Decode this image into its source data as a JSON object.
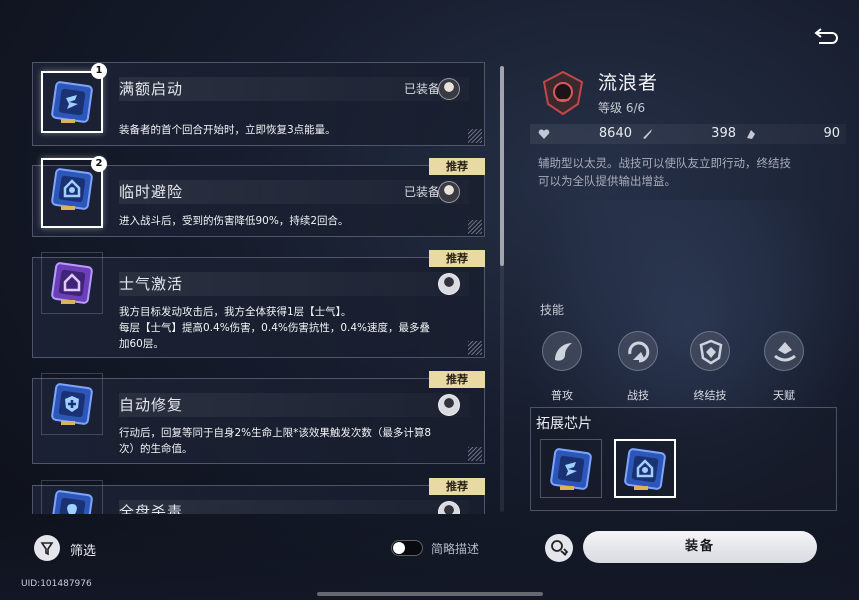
{
  "cards": [
    {
      "name": "满额启动",
      "equipped_label": "已装备",
      "number": "1",
      "desc": "装备者的首个回合开始时，立即恢复3点能量。"
    },
    {
      "name": "临时避险",
      "equipped_label": "已装备",
      "number": "2",
      "recommend": "推荐",
      "desc": "进入战斗后，受到的伤害降低90%，持续2回合。"
    },
    {
      "name": "士气激活",
      "recommend": "推荐",
      "desc_lines": [
        "我方目标发动攻击后，我方全体获得1层【士气】。",
        "每层【士气】提高0.4%伤害，0.4%伤害抗性，0.4%速度，最多叠",
        "加60层。"
      ]
    },
    {
      "name": "自动修复",
      "recommend": "推荐",
      "desc_lines": [
        "行动后，回复等同于自身2%生命上限*该效果触发次数（最多计算8",
        "次）的生命值。"
      ]
    },
    {
      "name": "全盘杀毒",
      "recommend": "推荐"
    }
  ],
  "controls": {
    "filter_label": "筛选",
    "brief_toggle_label": "简略描述",
    "uid": "UID:101487976"
  },
  "character": {
    "name": "流浪者",
    "level_label": "等级",
    "level_value": "6/6",
    "stats": {
      "hp": "8640",
      "atk": "398",
      "def": "90"
    },
    "desc_lines": [
      "辅助型以太灵。战技可以使队友立即行动，终结技",
      "可以为全队提供输出增益。"
    ]
  },
  "skills": {
    "section_label": "技能",
    "items": [
      {
        "label": "普攻",
        "icon": "normal-attack-icon"
      },
      {
        "label": "战技",
        "icon": "skill-icon"
      },
      {
        "label": "终结技",
        "icon": "ultimate-icon"
      },
      {
        "label": "天赋",
        "icon": "talent-icon"
      }
    ]
  },
  "extension": {
    "title": "拓展芯片"
  },
  "equip_button": "装备",
  "colors": {
    "accent": "#e9d9a3",
    "chip_blue": "#3a6fd8",
    "chip_purple": "#8a5cd8",
    "panel_border": "#b4bed7"
  }
}
